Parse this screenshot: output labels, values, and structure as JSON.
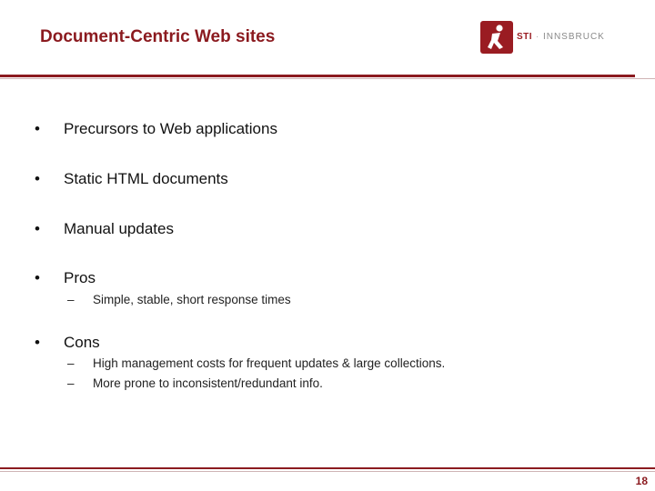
{
  "title": "Document-Centric Web sites",
  "logo": {
    "sti": "STI",
    "separator": " · ",
    "city": "INNSBRUCK"
  },
  "bullets": [
    {
      "text": "Precursors to Web applications",
      "subs": []
    },
    {
      "text": "Static HTML documents",
      "subs": []
    },
    {
      "text": "Manual updates",
      "subs": []
    },
    {
      "text": "Pros",
      "subs": [
        "Simple, stable, short response times"
      ]
    },
    {
      "text": "Cons",
      "subs": [
        "High management costs for frequent updates & large collections.",
        "More prone to inconsistent/redundant info."
      ]
    }
  ],
  "bullet_symbol": "•",
  "sub_symbol": "–",
  "page_number": "18",
  "colors": {
    "accent": "#8b1a1f",
    "logo": "#9a1c22"
  }
}
